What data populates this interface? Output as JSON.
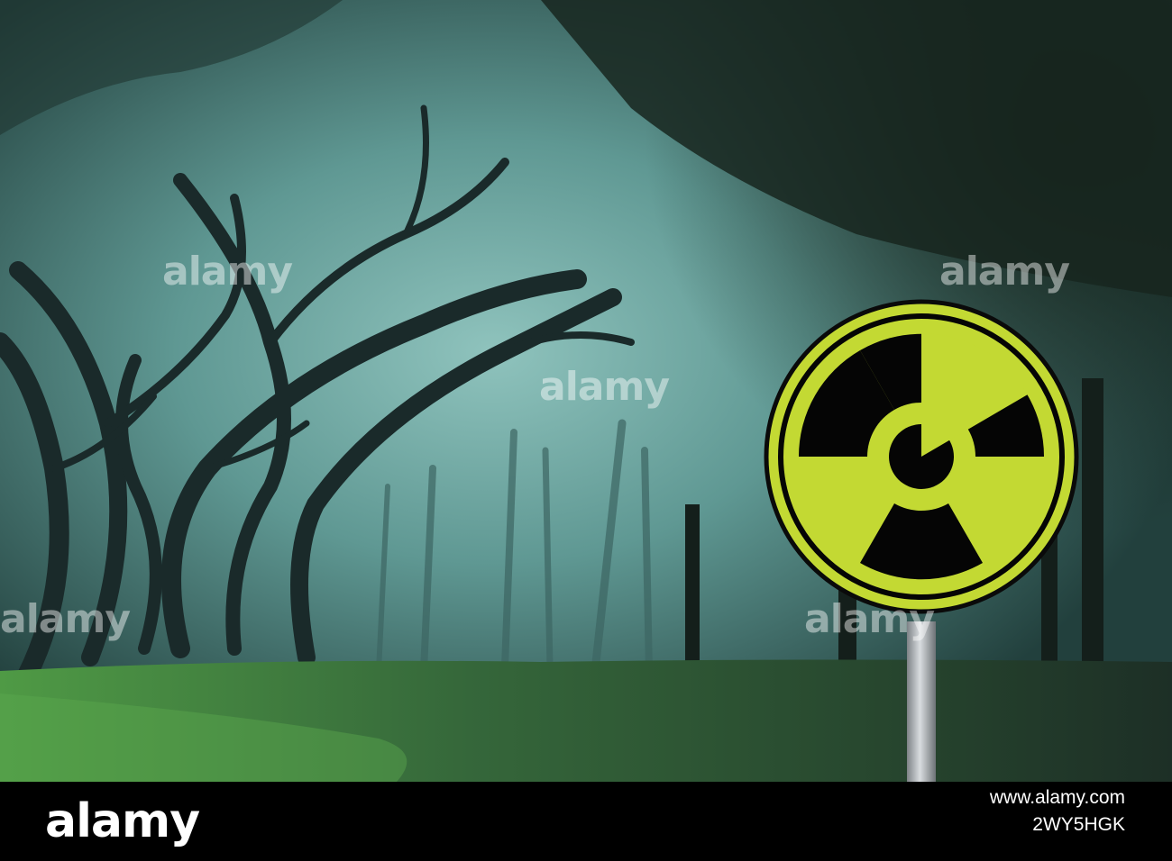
{
  "image": {
    "scene": "misty forest with radiation hazard sign",
    "sign": {
      "icon": "radiation-trefoil-icon",
      "face_color": "#c3d933",
      "symbol_color": "#050505",
      "pole_color": "#a9aeb2"
    },
    "palette": {
      "fog": "#6fa8a3",
      "canopy": "#1a2a25",
      "grass": "#3f7a3a"
    }
  },
  "watermark": {
    "text": "alamy"
  },
  "footer": {
    "logo": "alamy",
    "image_id": "2WY5HGK",
    "site": "www.alamy.com"
  }
}
